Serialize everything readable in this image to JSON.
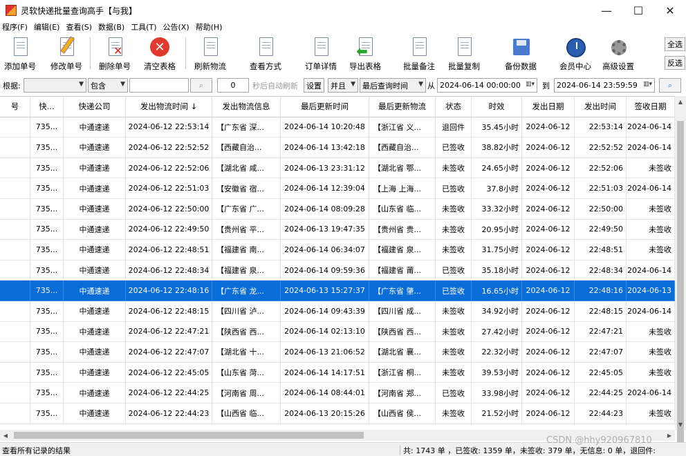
{
  "window": {
    "title": "灵软快递批量查询高手【与我】",
    "minimize": "—",
    "maximize": "☐",
    "close": "✕"
  },
  "menu": [
    "程序(F)",
    "编辑(E)",
    "查看(S)",
    "数据(B)",
    "工具(T)",
    "公告(X)",
    "帮助(H)"
  ],
  "toolbar": {
    "add": "添加单号",
    "edit": "修改单号",
    "delete": "删除单号",
    "clear": "清空表格",
    "refresh": "刷新物流",
    "view_mode": "查看方式",
    "order_detail": "订单详情",
    "export": "导出表格",
    "batch_note": "批量备注",
    "batch_copy": "批量复制",
    "backup": "备份数据",
    "member": "会员中心",
    "advanced": "高级设置",
    "select_all": "全选",
    "invert": "反选"
  },
  "filter": {
    "basis_label": "根据:",
    "basis_value": "",
    "contains_value": "包含",
    "keyword_value": "",
    "refresh_seconds": "0",
    "auto_refresh_label": "秒后自动刷新",
    "settings_label": "设置",
    "and_value": "并且",
    "time_field_value": "最后查询时间",
    "from_label": "从",
    "from_value": "2024-06-14 00:00:00",
    "to_label": "到",
    "to_value": "2024-06-14 23:59:59"
  },
  "grid": {
    "columns": [
      "号",
      "快...",
      "快递公司",
      "发出物流时间 ↓",
      "发出物流信息",
      "最后更新时间",
      "最后更新物流",
      "状态",
      "时效",
      "发出日期",
      "发出时间",
      "签收日期"
    ],
    "selected_index": 8,
    "rows": [
      [
        "",
        "735...",
        "中通速递",
        "2024-06-12 22:53:14",
        "【广东省 深...",
        "2024-06-14 10:20:48",
        "【浙江省 义...",
        "退回件",
        "35.45小时",
        "2024-06-12",
        "22:53:14",
        "2024-06-14"
      ],
      [
        "",
        "735...",
        "中通速递",
        "2024-06-12 22:52:52",
        "【西藏自治...",
        "2024-06-14 13:42:18",
        "【西藏自治...",
        "已签收",
        "38.82小时",
        "2024-06-12",
        "22:52:52",
        "2024-06-14"
      ],
      [
        "",
        "735...",
        "中通速递",
        "2024-06-12 22:52:06",
        "【湖北省 咸...",
        "2024-06-13 23:31:12",
        "【湖北省 鄂...",
        "未签收",
        "24.65小时",
        "2024-06-12",
        "22:52:06",
        "未签收"
      ],
      [
        "",
        "735...",
        "中通速递",
        "2024-06-12 22:51:03",
        "【安徽省 宿...",
        "2024-06-14 12:39:04",
        "【上海 上海...",
        "已签收",
        "37.8小时",
        "2024-06-12",
        "22:51:03",
        "2024-06-14"
      ],
      [
        "",
        "735...",
        "中通速递",
        "2024-06-12 22:50:00",
        "【广东省 广...",
        "2024-06-14 08:09:28",
        "【山东省 临...",
        "未签收",
        "33.32小时",
        "2024-06-12",
        "22:50:00",
        "未签收"
      ],
      [
        "",
        "735...",
        "中通速递",
        "2024-06-12 22:49:50",
        "【贵州省 平...",
        "2024-06-13 19:47:35",
        "【贵州省 贵...",
        "未签收",
        "20.95小时",
        "2024-06-12",
        "22:49:50",
        "未签收"
      ],
      [
        "",
        "735...",
        "中通速递",
        "2024-06-12 22:48:51",
        "【福建省 南...",
        "2024-06-14 06:34:07",
        "【福建省 泉...",
        "未签收",
        "31.75小时",
        "2024-06-12",
        "22:48:51",
        "未签收"
      ],
      [
        "",
        "735...",
        "中通速递",
        "2024-06-12 22:48:34",
        "【福建省 泉...",
        "2024-06-14 09:59:36",
        "【福建省 莆...",
        "已签收",
        "35.18小时",
        "2024-06-12",
        "22:48:34",
        "2024-06-14"
      ],
      [
        "",
        "735...",
        "中通速递",
        "2024-06-12 22:48:16",
        "【广东省 龙...",
        "2024-06-13 15:27:37",
        "【广东省 肇...",
        "已签收",
        "16.65小时",
        "2024-06-12",
        "22:48:16",
        "2024-06-13"
      ],
      [
        "",
        "735...",
        "中通速递",
        "2024-06-12 22:48:15",
        "【四川省 泸...",
        "2024-06-14 09:43:39",
        "【四川省 成...",
        "未签收",
        "34.92小时",
        "2024-06-12",
        "22:48:15",
        "2024-06-14"
      ],
      [
        "",
        "735...",
        "中通速递",
        "2024-06-12 22:47:21",
        "【陕西省 西...",
        "2024-06-14 02:13:10",
        "【陕西省 西...",
        "未签收",
        "27.42小时",
        "2024-06-12",
        "22:47:21",
        "未签收"
      ],
      [
        "",
        "735...",
        "中通速递",
        "2024-06-12 22:47:07",
        "【湖北省 十...",
        "2024-06-13 21:06:52",
        "【湖北省 襄...",
        "未签收",
        "22.32小时",
        "2024-06-12",
        "22:47:07",
        "未签收"
      ],
      [
        "",
        "735...",
        "中通速递",
        "2024-06-12 22:45:05",
        "【山东省 菏...",
        "2024-06-14 14:17:51",
        "【浙江省 桐...",
        "未签收",
        "39.53小时",
        "2024-06-12",
        "22:45:05",
        "未签收"
      ],
      [
        "",
        "735...",
        "中通速递",
        "2024-06-12 22:44:25",
        "【河南省 周...",
        "2024-06-14 08:44:01",
        "【河南省 郑...",
        "已签收",
        "33.98小时",
        "2024-06-12",
        "22:44:25",
        "2024-06-14"
      ],
      [
        "",
        "735...",
        "中通速递",
        "2024-06-12 22:44:23",
        "【山西省 临...",
        "2024-06-13 20:15:26",
        "【山西省 侯...",
        "未签收",
        "21.52小时",
        "2024-06-12",
        "22:44:23",
        "未签收"
      ]
    ]
  },
  "status": {
    "left": "查看所有记录的结果",
    "right": "共: 1743 单 ，已签收:  1359 单，未签收:  379 单，无信息: 0 单，退回件:"
  },
  "watermark": "CSDN @hhy920967810"
}
